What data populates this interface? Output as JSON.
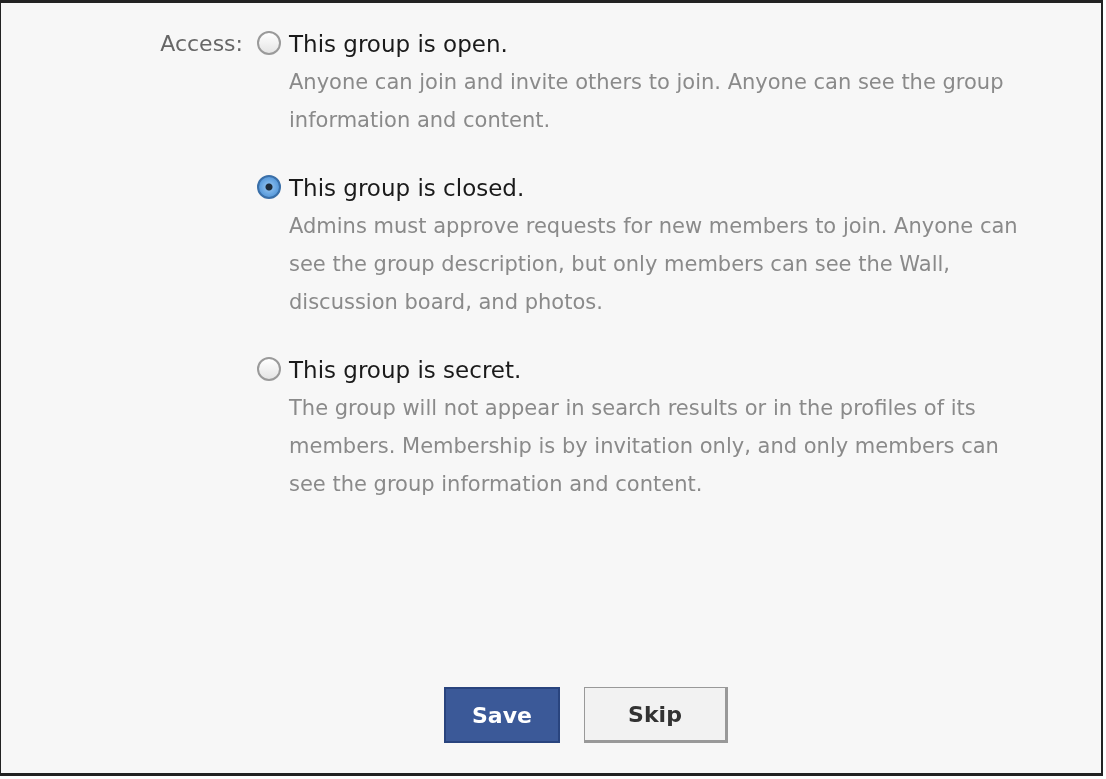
{
  "access_label": "Access:",
  "options": [
    {
      "title": "This group is open.",
      "description": "Anyone can join and invite others to join. Anyone can see the group information and content.",
      "selected": false
    },
    {
      "title": "This group is closed.",
      "description": "Admins must approve requests for new members to join. Anyone can see the group description, but only members can see the Wall, discussion board, and photos.",
      "selected": true
    },
    {
      "title": "This group is secret.",
      "description": "The group will not appear in search results or in the profiles of its members. Membership is by invitation only, and only members can see the group information and content.",
      "selected": false
    }
  ],
  "buttons": [
    {
      "label": "Save",
      "kind": "primary"
    },
    {
      "label": "Skip",
      "kind": "secondary"
    }
  ]
}
